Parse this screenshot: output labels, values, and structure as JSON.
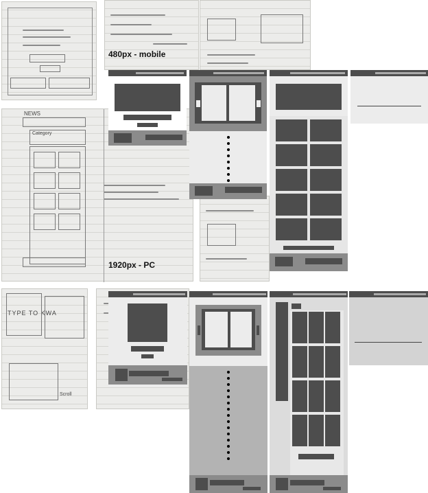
{
  "labels": {
    "mobile": "480px - mobile",
    "pc": "1920px - PC"
  },
  "sketch_text": {
    "news": "NEWS",
    "ticker": "TYPE TO KWA",
    "category": "Category",
    "scroll": "Scroll"
  }
}
